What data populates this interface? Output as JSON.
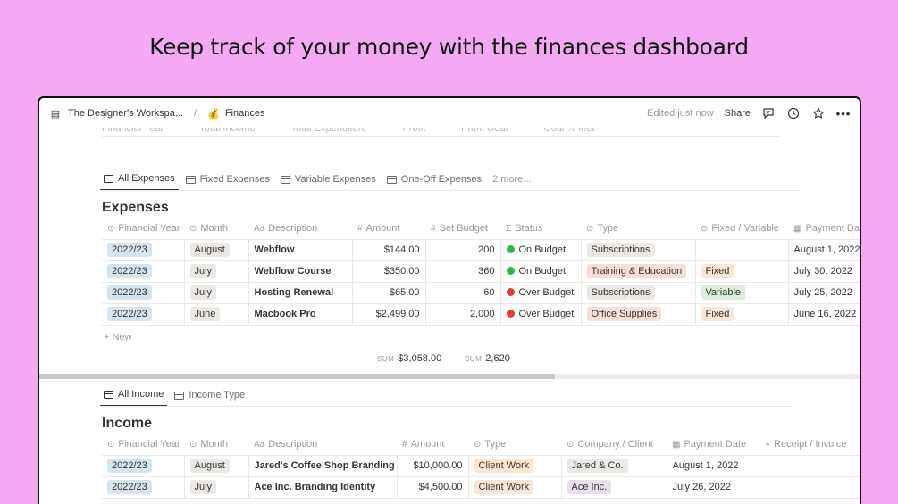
{
  "headline": "Keep track of your money with the finances dashboard",
  "topbar": {
    "workspace": "The Designer's Workspa...",
    "separator": "/",
    "page_emoji": "💰",
    "page": "Finances",
    "edited": "Edited just now",
    "share": "Share"
  },
  "ghost_headers": [
    "Financial Year",
    "Total Income",
    "Total Expenditure",
    "Profit",
    "Profit Goal",
    "Goal % Met"
  ],
  "expenses": {
    "tabs": [
      "All Expenses",
      "Fixed Expenses",
      "Variable Expenses",
      "One-Off Expenses"
    ],
    "more": "2 more...",
    "title": "Expenses",
    "columns": [
      "Financial Year",
      "Month",
      "Description",
      "Amount",
      "Set Budget",
      "Status",
      "Type",
      "Fixed / Variable",
      "Payment Da"
    ],
    "rows": [
      {
        "year": "2022/23",
        "month": "August",
        "desc": "Webflow",
        "amount": "$144.00",
        "budget": "200",
        "status": "On Budget",
        "status_color": "#2fb84f",
        "type": "Subscriptions",
        "type_bg": "#ebe8e5",
        "fv": "",
        "fv_bg": "",
        "date": "August 1, 2022"
      },
      {
        "year": "2022/23",
        "month": "July",
        "desc": "Webflow Course",
        "amount": "$350.00",
        "budget": "360",
        "status": "On Budget",
        "status_color": "#2fb84f",
        "type": "Training & Education",
        "type_bg": "#f6dfd7",
        "fv": "Fixed",
        "fv_bg": "#fbe5d4",
        "date": "July 30, 2022"
      },
      {
        "year": "2022/23",
        "month": "July",
        "desc": "Hosting Renewal",
        "amount": "$65.00",
        "budget": "60",
        "status": "Over Budget",
        "status_color": "#e03e3e",
        "type": "Subscriptions",
        "type_bg": "#ebe8e5",
        "fv": "Variable",
        "fv_bg": "#dbeddb",
        "date": "July 25, 2022"
      },
      {
        "year": "2022/23",
        "month": "June",
        "desc": "Macbook Pro",
        "amount": "$2,499.00",
        "budget": "2,000",
        "status": "Over Budget",
        "status_color": "#e03e3e",
        "type": "Office Supplies",
        "type_bg": "#f6dfd7",
        "fv": "Fixed",
        "fv_bg": "#fbe5d4",
        "date": "June 16, 2022"
      }
    ],
    "new_label": "New",
    "sum_label": "SUM",
    "sum_amount": "$3,058.00",
    "sum_budget": "2,620"
  },
  "income": {
    "tabs": [
      "All Income",
      "Income Type"
    ],
    "title": "Income",
    "columns": [
      "Financial Year",
      "Month",
      "Description",
      "Amount",
      "Type",
      "Company / Client",
      "Payment Date",
      "Receipt / Invoice"
    ],
    "rows": [
      {
        "year": "2022/23",
        "month": "August",
        "desc": "Jared's Coffee Shop Branding",
        "amount": "$10,000.00",
        "type": "Client Work",
        "company": "Jared & Co.",
        "company_bg": "#ebe8e5",
        "date": "August 1, 2022"
      },
      {
        "year": "2022/23",
        "month": "July",
        "desc": "Ace Inc. Branding Identity",
        "amount": "$4,500.00",
        "type": "Client Work",
        "company": "Ace Inc.",
        "company_bg": "#e8deee",
        "date": "July 26, 2022"
      }
    ]
  },
  "colors": {
    "background": "#f5a9f2",
    "year_tag": "#d3e5ef",
    "month_tag": "#ebe8e5",
    "client_work": "#fbe5d4"
  }
}
